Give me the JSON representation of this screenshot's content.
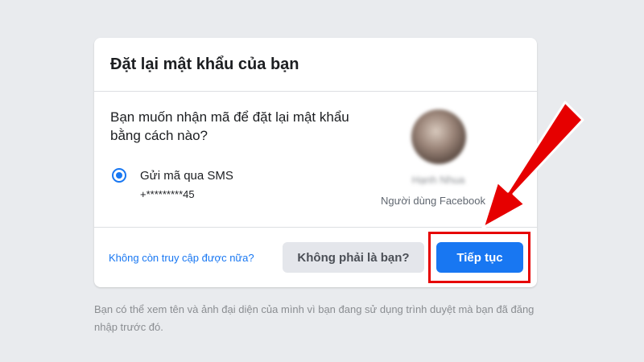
{
  "dialog": {
    "title": "Đặt lại mật khẩu của bạn",
    "question": "Bạn muốn nhận mã để đặt lại mật khẩu bằng cách nào?",
    "option": {
      "label": "Gửi mã qua SMS",
      "phone": "+*********45",
      "selected": true
    },
    "user": {
      "name": "Hạnh Nhua",
      "type": "Người dùng Facebook"
    },
    "footer": {
      "no_access_link": "Không còn truy cập được nữa?",
      "not_you_button": "Không phải là bạn?",
      "continue_button": "Tiếp tục"
    }
  },
  "note": "Bạn có thể xem tên và ảnh đại diện của mình vì bạn đang sử dụng trình duyệt mà bạn đã đăng nhập trước đó.",
  "colors": {
    "background": "#e9ebee",
    "primary": "#1877f2",
    "annotation": "#e60000"
  }
}
